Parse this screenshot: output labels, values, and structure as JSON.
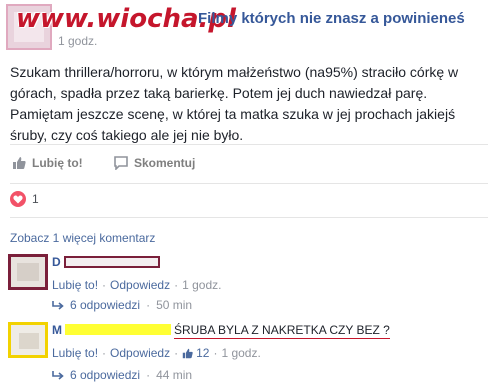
{
  "post": {
    "watermark": "www.wiocha.pl",
    "page_title": "Filmy których nie znasz a powinieneś",
    "time": "1 godz.",
    "body": "Szukam thrillera/horroru, w którym małżeństwo (na95%) straciło córkę w górach, spadła przez taką barierkę. Potem jej duch nawiedzał parę. Pamiętam jeszcze scenę, w której ta matka szuka w jej prochach jakiejś śruby, czy coś takiego ale jej nie było.",
    "like_label": "Lubię to!",
    "comment_label": "Skomentuj",
    "reaction_count": "1"
  },
  "comments_section": {
    "view_more": "Zobacz 1 więcej komentarz",
    "comments": [
      {
        "name": "D",
        "text": "",
        "like_label": "Lubię to!",
        "reply_label": "Odpowiedz",
        "time": "1 godz.",
        "likes": "",
        "replies_label": "6 odpowiedzi",
        "replies_time": "50 min"
      },
      {
        "name": "M",
        "text": "ŚRUBA BYLA Z NAKRETKA CZY BEZ ?",
        "like_label": "Lubię to!",
        "reply_label": "Odpowiedz",
        "time": "1 godz.",
        "likes": "12",
        "replies_label": "6 odpowiedzi",
        "replies_time": "44 min"
      }
    ]
  },
  "colors": {
    "link": "#365899",
    "meta": "#90949c",
    "heart": "#f25268",
    "watermark": "#c5162c",
    "highlight": "#ffff33",
    "redact": "#7a1f3a"
  }
}
